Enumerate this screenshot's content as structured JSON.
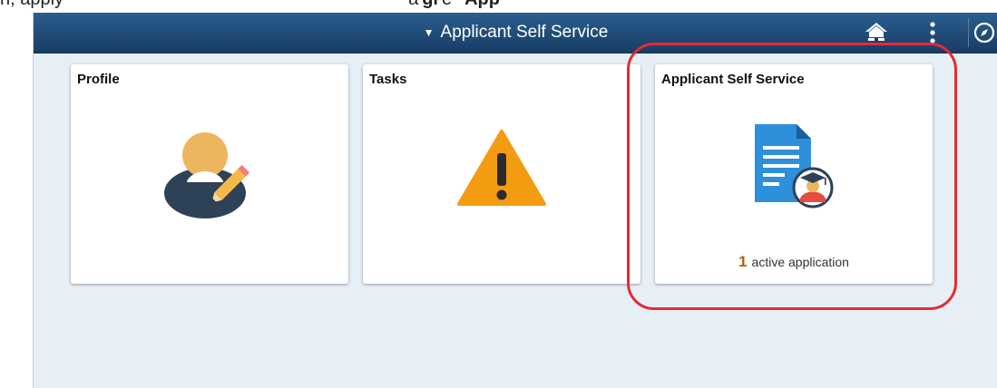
{
  "caption": {
    "prefix": "n, apply",
    "middle": "a",
    "strong_partial": "gi",
    "suffix": "e",
    "strong_end": "App"
  },
  "navbar": {
    "title": "Applicant Self Service",
    "caret_icon": "caret-down-icon",
    "home_icon": "home-icon",
    "actions_icon": "more-vertical-icon",
    "navbar_icon": "compass-icon"
  },
  "tiles": [
    {
      "title": "Profile",
      "icon": "profile-edit-icon"
    },
    {
      "title": "Tasks",
      "icon": "warning-icon"
    },
    {
      "title": "Applicant Self Service",
      "icon": "application-document-icon",
      "count": "1",
      "count_label": "active application"
    }
  ],
  "colors": {
    "navbar": "#1f4b79",
    "background": "#e6eef6",
    "highlight": "#e22b35",
    "warning": "#f39c12",
    "document": "#2e8fdb",
    "count": "#b75c10"
  }
}
